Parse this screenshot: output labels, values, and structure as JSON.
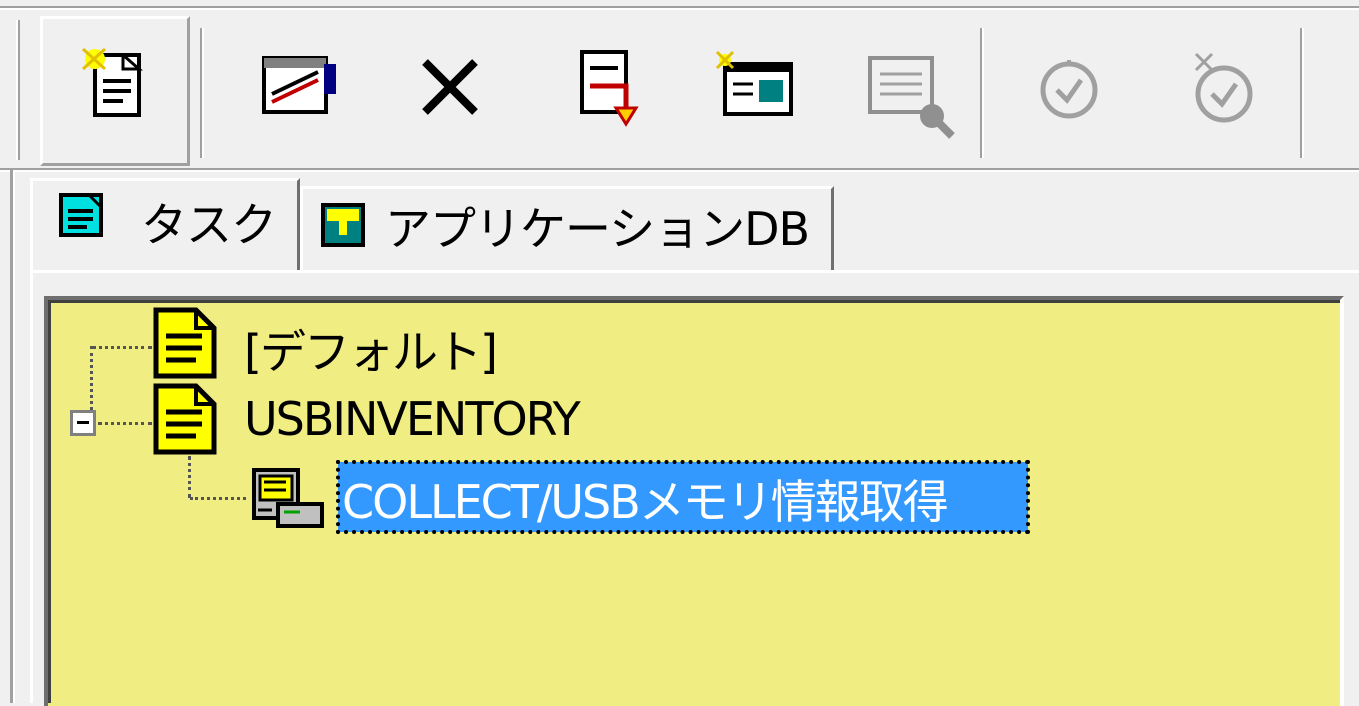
{
  "toolbar": {
    "buttons": [
      {
        "name": "new-task-icon",
        "pressed": true
      },
      {
        "name": "edit-task-icon",
        "pressed": false
      },
      {
        "name": "delete-icon",
        "pressed": false
      },
      {
        "name": "import-icon",
        "pressed": false
      },
      {
        "name": "new-window-icon",
        "pressed": false
      },
      {
        "name": "search-disabled-icon",
        "pressed": false,
        "disabled": true
      },
      {
        "name": "clock-disabled-icon",
        "pressed": false,
        "disabled": true
      },
      {
        "name": "clock-new-disabled-icon",
        "pressed": false,
        "disabled": true
      }
    ]
  },
  "tabs": [
    {
      "label": "タスク",
      "icon": "task-tab-icon",
      "active": true
    },
    {
      "label": "アプリケーションDB",
      "icon": "appdb-tab-icon",
      "active": false
    }
  ],
  "tree": {
    "items": [
      {
        "label": "[デフォルト]",
        "icon": "task-folder-icon",
        "level": 0
      },
      {
        "label": "USBINVENTORY",
        "icon": "task-folder-icon",
        "level": 0,
        "expanded": true
      },
      {
        "label": "COLLECT/USBメモリ情報取得",
        "icon": "computer-task-icon",
        "level": 1,
        "selected": true
      }
    ]
  },
  "colors": {
    "tree_background": "#f0ee82",
    "selection": "#3399ff",
    "toolbar_background": "#f0f0f0"
  }
}
